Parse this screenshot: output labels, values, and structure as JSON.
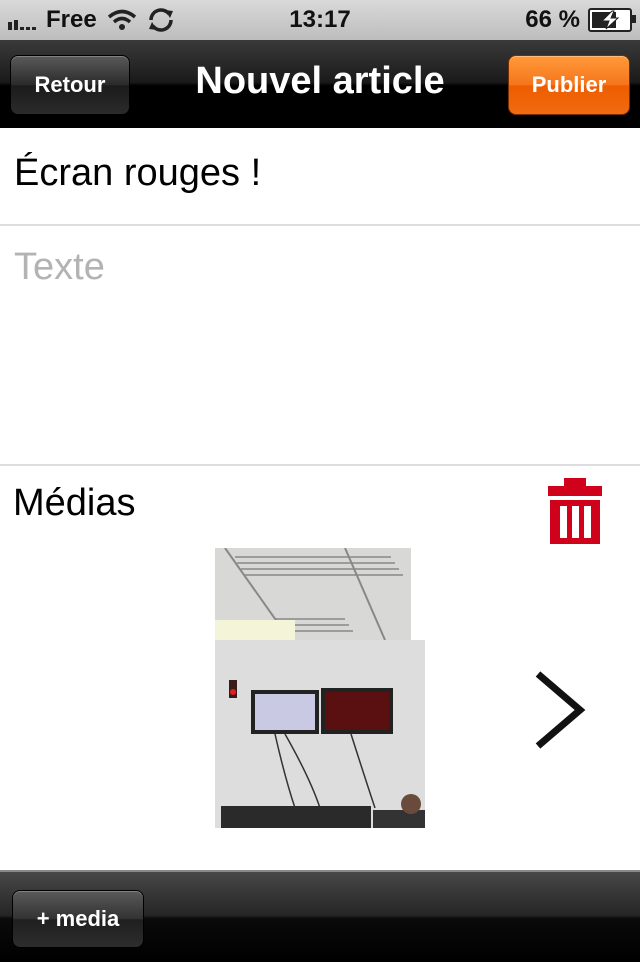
{
  "status": {
    "carrier": "Free",
    "time": "13:17",
    "battery_label": "66 %",
    "battery_level": 0.66,
    "icons": [
      "signal-icon",
      "wifi-icon",
      "sync-icon",
      "battery-charging-icon"
    ]
  },
  "nav": {
    "title": "Nouvel article",
    "back_label": "Retour",
    "publish_label": "Publier",
    "publish_color": "#f36a10"
  },
  "form": {
    "title_value": "Écran rouges !",
    "text_placeholder": "Texte"
  },
  "media": {
    "label": "Médias",
    "delete_icon": "trash-icon",
    "delete_color": "#d0021b",
    "next_icon": "chevron-right-icon"
  },
  "toolbar": {
    "add_media_label": "+ media"
  }
}
